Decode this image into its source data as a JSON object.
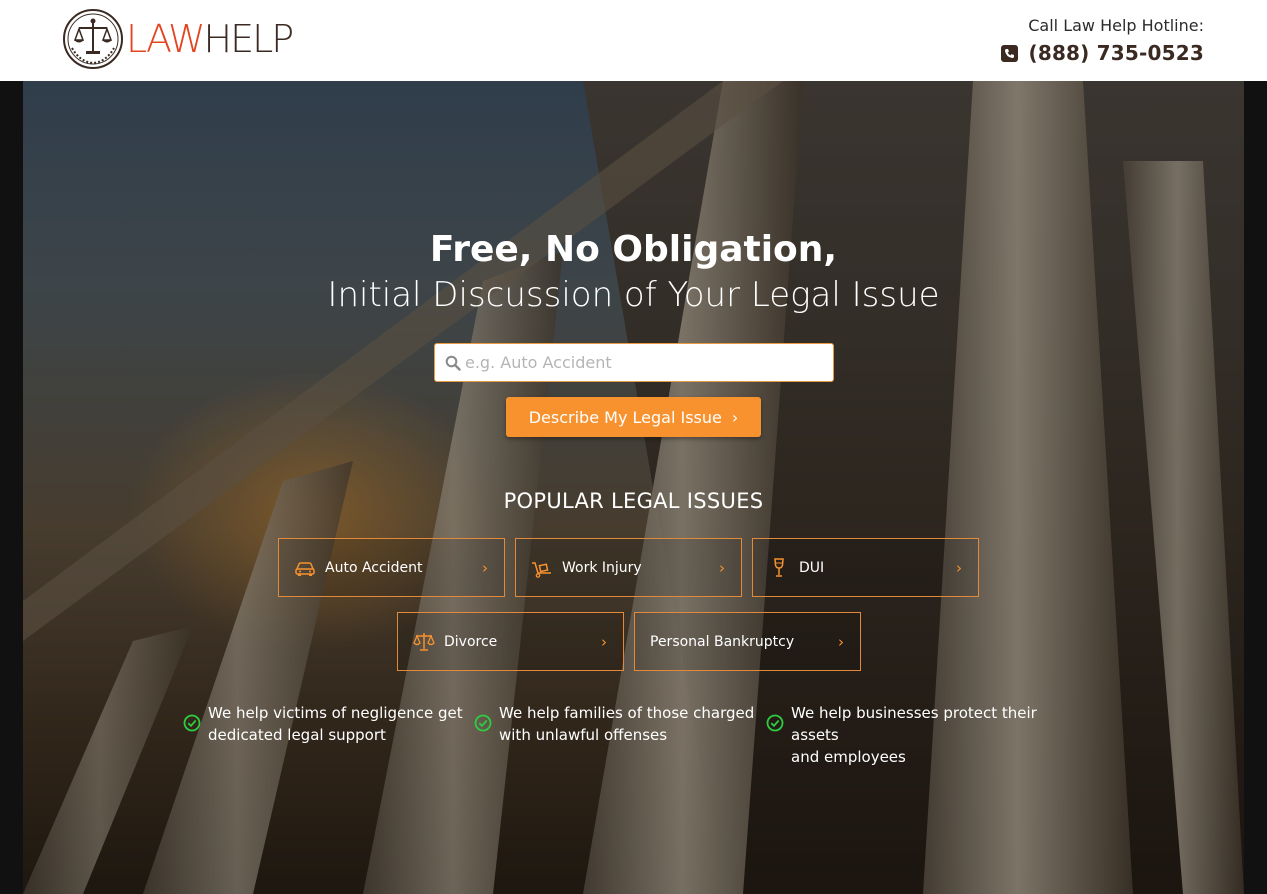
{
  "header": {
    "logo": {
      "part1": "LAW",
      "part2": "HELP",
      "emblem_icon": "scales-of-justice-icon"
    },
    "hotline_label": "Call Law Help Hotline:",
    "hotline_number": "(888) 735-0523",
    "phone_icon": "phone-icon"
  },
  "hero": {
    "title_line1": "Free, No Obligation,",
    "title_line2": "Initial Discussion of Your Legal Issue",
    "search": {
      "placeholder": "e.g. Auto Accident",
      "value": "",
      "icon": "search-icon"
    },
    "cta_label": "Describe My Legal Issue",
    "cta_icon": "chevron-right-icon",
    "popular_heading": "POPULAR LEGAL ISSUES",
    "issues": [
      {
        "label": "Auto Accident",
        "icon": "car-icon"
      },
      {
        "label": "Work Injury",
        "icon": "hand-truck-icon"
      },
      {
        "label": "DUI",
        "icon": "wine-glass-icon"
      },
      {
        "label": "Divorce",
        "icon": "scales-icon"
      },
      {
        "label": "Personal Bankruptcy",
        "icon": ""
      }
    ],
    "bullets": [
      {
        "text_line1": "We help victims of negligence get",
        "text_line2": "dedicated legal support"
      },
      {
        "text_line1": "We help families of those charged",
        "text_line2": "with unlawful offenses"
      },
      {
        "text_line1": "We help businesses protect their assets",
        "text_line2": "and employees"
      }
    ]
  },
  "colors": {
    "accent_orange": "#f7922e",
    "logo_red": "#e2451f",
    "logo_brown": "#3a2a22",
    "check_green": "#2ecc40",
    "issue_border": "#e38a3a"
  }
}
